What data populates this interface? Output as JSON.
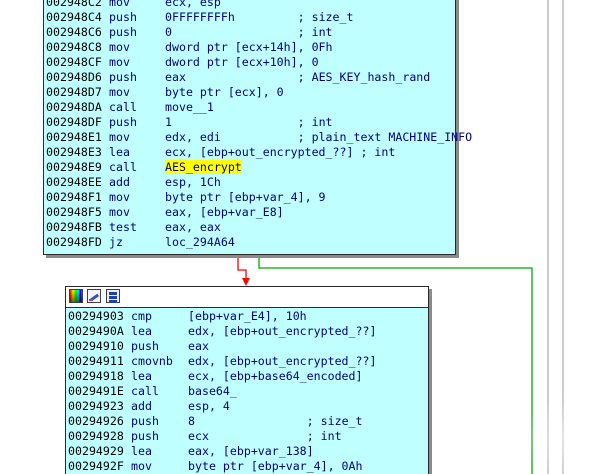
{
  "colors": {
    "block_background": "#c0ffff",
    "address": "#000000",
    "mnemonic": "#000080",
    "number": "#008000",
    "highlight": "#ffff00",
    "edge_false": "#ff0000",
    "edge_true": "#00aa00",
    "edge_gray": "#808080"
  },
  "top_block": {
    "lines": [
      {
        "addr": "002948C2",
        "mnem": "mov",
        "ops": "ecx, esp",
        "comment": ""
      },
      {
        "addr": "002948C4",
        "mnem": "push",
        "ops": "0FFFFFFFFh",
        "comment": "; size_t"
      },
      {
        "addr": "002948C6",
        "mnem": "push",
        "ops": "0",
        "comment": "; int"
      },
      {
        "addr": "002948C8",
        "mnem": "mov",
        "ops": "dword ptr [ecx+14h], 0Fh",
        "comment": ""
      },
      {
        "addr": "002948CF",
        "mnem": "mov",
        "ops": "dword ptr [ecx+10h], 0",
        "comment": ""
      },
      {
        "addr": "002948D6",
        "mnem": "push",
        "ops": "eax",
        "comment": "; AES_KEY_hash_rand"
      },
      {
        "addr": "002948D7",
        "mnem": "mov",
        "ops": "byte ptr [ecx], 0",
        "comment": ""
      },
      {
        "addr": "002948DA",
        "mnem": "call",
        "ops": "move__1",
        "comment": ""
      },
      {
        "addr": "002948DF",
        "mnem": "push",
        "ops": "1",
        "comment": "; int"
      },
      {
        "addr": "002948E1",
        "mnem": "mov",
        "ops": "edx, edi",
        "comment": "; plain_text MACHINE_INFO"
      },
      {
        "addr": "002948E3",
        "mnem": "lea",
        "ops": "ecx, [ebp+out_encrypted_??]",
        "comment": "; int"
      },
      {
        "addr": "002948E9",
        "mnem": "call",
        "ops": "AES_encrypt",
        "comment": ""
      },
      {
        "addr": "002948EE",
        "mnem": "add",
        "ops": "esp, 1Ch",
        "comment": ""
      },
      {
        "addr": "002948F1",
        "mnem": "mov",
        "ops": "byte ptr [ebp+var_4], 9",
        "comment": ""
      },
      {
        "addr": "002948F5",
        "mnem": "mov",
        "ops": "eax, [ebp+var_E8]",
        "comment": ""
      },
      {
        "addr": "002948FB",
        "mnem": "test",
        "ops": "eax, eax",
        "comment": ""
      },
      {
        "addr": "002948FD",
        "mnem": "jz",
        "ops": "loc_294A64",
        "comment": ""
      }
    ]
  },
  "bottom_block": {
    "lines": [
      {
        "addr": "00294903",
        "mnem": "cmp",
        "ops": "[ebp+var_E4], 10h",
        "comment": ""
      },
      {
        "addr": "0029490A",
        "mnem": "lea",
        "ops": "edx, [ebp+out_encrypted_??]",
        "comment": ""
      },
      {
        "addr": "00294910",
        "mnem": "push",
        "ops": "eax",
        "comment": ""
      },
      {
        "addr": "00294911",
        "mnem": "cmovnb",
        "ops": "edx, [ebp+out_encrypted_??]",
        "comment": ""
      },
      {
        "addr": "00294918",
        "mnem": "lea",
        "ops": "ecx, [ebp+base64_encoded]",
        "comment": ""
      },
      {
        "addr": "0029491E",
        "mnem": "call",
        "ops": "base64_",
        "comment": ""
      },
      {
        "addr": "00294923",
        "mnem": "add",
        "ops": "esp, 4",
        "comment": ""
      },
      {
        "addr": "00294926",
        "mnem": "push",
        "ops": "8",
        "comment": "; size_t"
      },
      {
        "addr": "00294928",
        "mnem": "push",
        "ops": "ecx",
        "comment": "; int"
      },
      {
        "addr": "00294929",
        "mnem": "lea",
        "ops": "eax, [ebp+var_138]",
        "comment": ""
      },
      {
        "addr": "0029492F",
        "mnem": "mov",
        "ops": "byte ptr [ebp+var_4], 0Ah",
        "comment": ""
      }
    ]
  },
  "icons": [
    "color-palette-icon",
    "rename-icon",
    "graph-view-icon"
  ]
}
